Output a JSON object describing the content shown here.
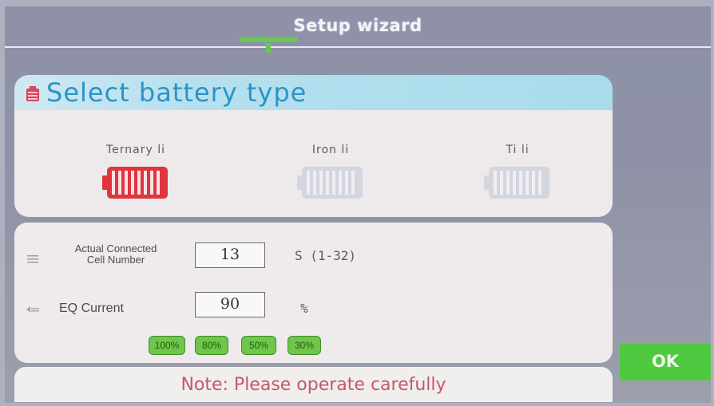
{
  "header": {
    "title": "Setup wizard"
  },
  "battery_section": {
    "title": "Select battery type",
    "options": [
      {
        "label": "Ternary li",
        "selected": true
      },
      {
        "label": "Iron li",
        "selected": false
      },
      {
        "label": "Ti li",
        "selected": false
      }
    ]
  },
  "settings": {
    "cell_number": {
      "label_line1": "Actual Connected",
      "label_line2": "Cell Number",
      "value": "13",
      "unit": "S  (1-32)"
    },
    "eq_current": {
      "label": "EQ Current",
      "value": "90",
      "unit": "%"
    },
    "presets": [
      "100%",
      "80%",
      "50%",
      "30%"
    ]
  },
  "note": "Note: Please operate carefully",
  "ok_button": "OK",
  "colors": {
    "selected_battery": "#e0353f",
    "unselected_battery": "#c9cad6",
    "accent_green": "#4fc93f",
    "header_blue": "#2b93c7",
    "note_red": "#c45969"
  }
}
